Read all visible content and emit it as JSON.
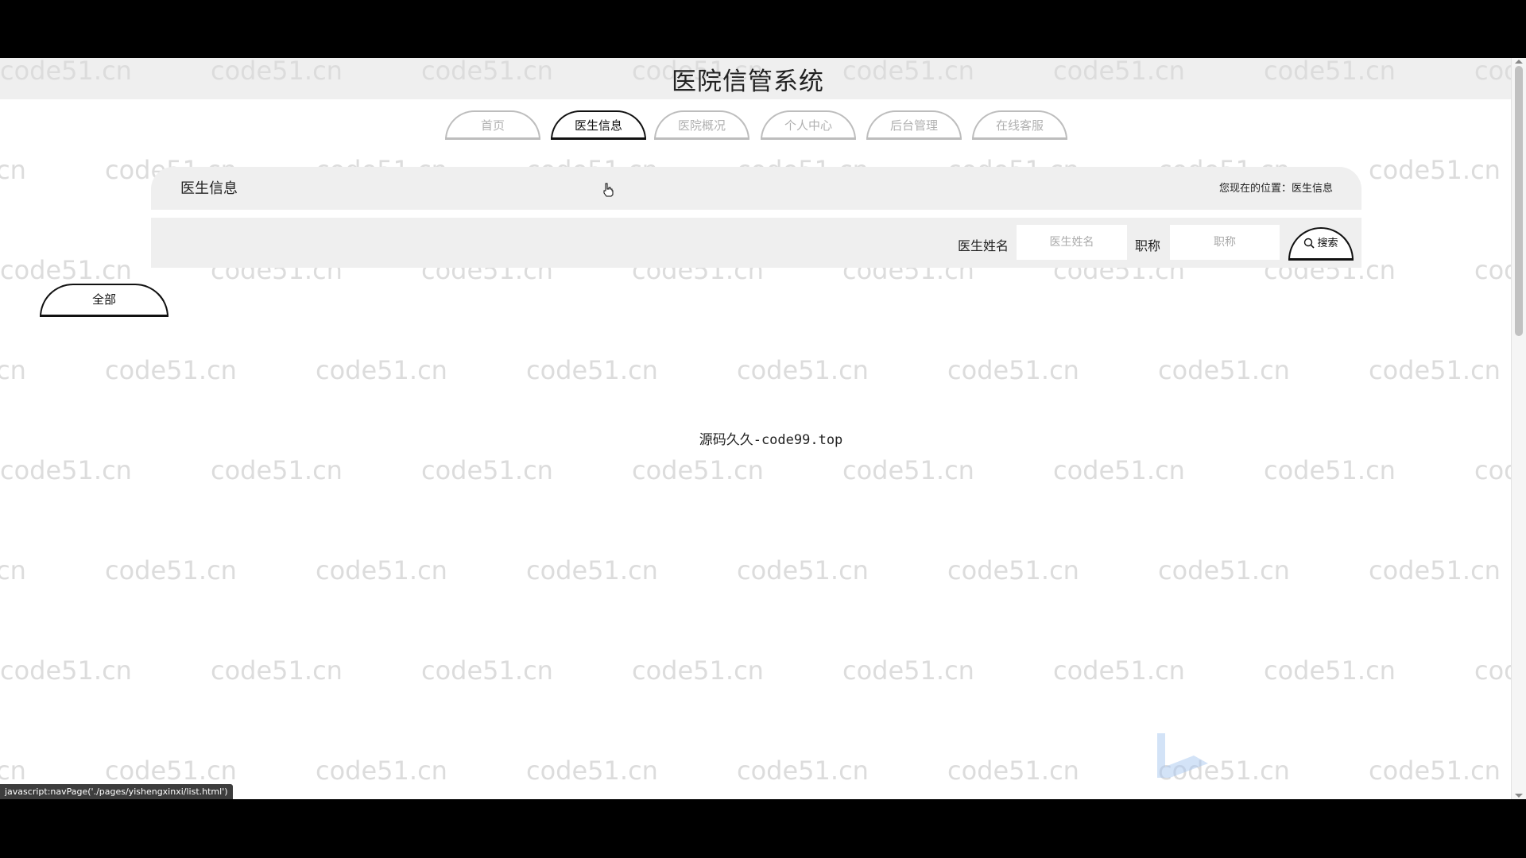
{
  "site": {
    "title": "医院信管系统"
  },
  "nav": {
    "items": [
      {
        "label": "首页",
        "active": false
      },
      {
        "label": "医生信息",
        "active": true
      },
      {
        "label": "医院概况",
        "active": false
      },
      {
        "label": "个人中心",
        "active": false
      },
      {
        "label": "后台管理",
        "active": false
      },
      {
        "label": "在线客服",
        "active": false
      }
    ]
  },
  "section": {
    "title": "医生信息",
    "breadcrumb": "您现在的位置：医生信息"
  },
  "search": {
    "name_label": "医生姓名",
    "name_placeholder": "医生姓名",
    "title_label": "职称",
    "title_placeholder": "职称",
    "button_label": "搜索"
  },
  "category": {
    "all_label": "全部"
  },
  "content": {
    "empty_note": "源码久久-code99.top"
  },
  "watermark": {
    "text": "code51.cn"
  },
  "status_bar": {
    "url": "javascript:navPage('./pages/yishengxinxi/list.html')"
  },
  "colors": {
    "accent": "#111111",
    "inactive": "#bdbdbd",
    "panel": "#efefef"
  }
}
